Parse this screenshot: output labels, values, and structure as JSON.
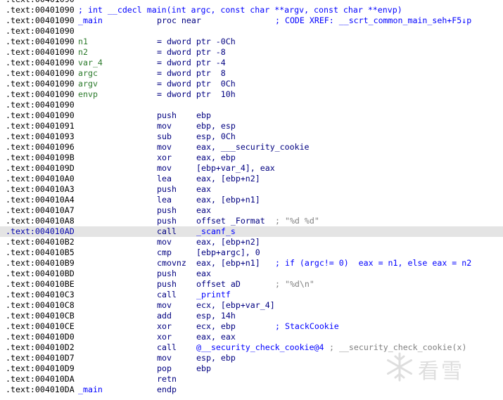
{
  "watermark": {
    "text": "看雪",
    "icon": "snowflake-icon"
  },
  "lines": [
    {
      "addr": ".text:00401090",
      "raw": ""
    },
    {
      "addr": ".text:00401090",
      "raw": "; int __cdecl main(int argc, const char **argv, const char **envp)"
    },
    {
      "addr": ".text:00401090",
      "label": "_main",
      "mn": "proc near",
      "tail": "; CODE XREF: __scrt_common_main_seh+F5↓p"
    },
    {
      "addr": ".text:00401090"
    },
    {
      "addr": ".text:00401090",
      "label": "n1",
      "mn": "= dword ptr -0Ch"
    },
    {
      "addr": ".text:00401090",
      "label": "n2",
      "mn": "= dword ptr -8"
    },
    {
      "addr": ".text:00401090",
      "label": "var_4",
      "mn": "= dword ptr -4"
    },
    {
      "addr": ".text:00401090",
      "label": "argc",
      "mn": "= dword ptr  8"
    },
    {
      "addr": ".text:00401090",
      "label": "argv",
      "mn": "= dword ptr  0Ch"
    },
    {
      "addr": ".text:00401090",
      "label": "envp",
      "mn": "= dword ptr  10h"
    },
    {
      "addr": ".text:00401090"
    },
    {
      "addr": ".text:00401090",
      "mn": "push",
      "op": "ebp"
    },
    {
      "addr": ".text:00401091",
      "mn": "mov",
      "op": "ebp, esp"
    },
    {
      "addr": ".text:00401093",
      "mn": "sub",
      "op": "esp, 0Ch"
    },
    {
      "addr": ".text:00401096",
      "mn": "mov",
      "op": "eax, ___security_cookie"
    },
    {
      "addr": ".text:0040109B",
      "mn": "xor",
      "op": "eax, ebp"
    },
    {
      "addr": ".text:0040109D",
      "mn": "mov",
      "op": "[ebp+var_4], eax"
    },
    {
      "addr": ".text:004010A0",
      "mn": "lea",
      "op": "eax, [ebp+n2]"
    },
    {
      "addr": ".text:004010A3",
      "mn": "push",
      "op": "eax"
    },
    {
      "addr": ".text:004010A4",
      "mn": "lea",
      "op": "eax, [ebp+n1]"
    },
    {
      "addr": ".text:004010A7",
      "mn": "push",
      "op": "eax"
    },
    {
      "addr": ".text:004010A8",
      "mn": "push",
      "op": "offset _Format",
      "cmt": "; \"%d %d\""
    },
    {
      "addr": ".text:004010AD",
      "mn": "call",
      "op": "_scanf_s",
      "hl": true
    },
    {
      "addr": ".text:004010B2",
      "mn": "mov",
      "op": "eax, [ebp+n2]"
    },
    {
      "addr": ".text:004010B5",
      "mn": "cmp",
      "op": "[ebp+argc], 0"
    },
    {
      "addr": ".text:004010B9",
      "mn": "cmovnz",
      "op": "eax, [ebp+n1]",
      "cmt": "; if (argc!= 0)  eax = n1, else eax = n2"
    },
    {
      "addr": ".text:004010BD",
      "mn": "push",
      "op": "eax"
    },
    {
      "addr": ".text:004010BE",
      "mn": "push",
      "op": "offset aD",
      "cmt": "; \"%d\\n\""
    },
    {
      "addr": ".text:004010C3",
      "mn": "call",
      "op": "_printf"
    },
    {
      "addr": ".text:004010C8",
      "mn": "mov",
      "op": "ecx, [ebp+var_4]"
    },
    {
      "addr": ".text:004010CB",
      "mn": "add",
      "op": "esp, 14h"
    },
    {
      "addr": ".text:004010CE",
      "mn": "xor",
      "op": "ecx, ebp",
      "cmt": "; StackCookie"
    },
    {
      "addr": ".text:004010D0",
      "mn": "xor",
      "op": "eax, eax"
    },
    {
      "addr": ".text:004010D2",
      "mn": "call",
      "op": "@__security_check_cookie@4",
      "cmt": "; __security_check_cookie(x)"
    },
    {
      "addr": ".text:004010D7",
      "mn": "mov",
      "op": "esp, ebp"
    },
    {
      "addr": ".text:004010D9",
      "mn": "pop",
      "op": "ebp"
    },
    {
      "addr": ".text:004010DA",
      "mn": "retn"
    },
    {
      "addr": ".text:004010DA",
      "label": "_main",
      "mn": "endp"
    }
  ]
}
